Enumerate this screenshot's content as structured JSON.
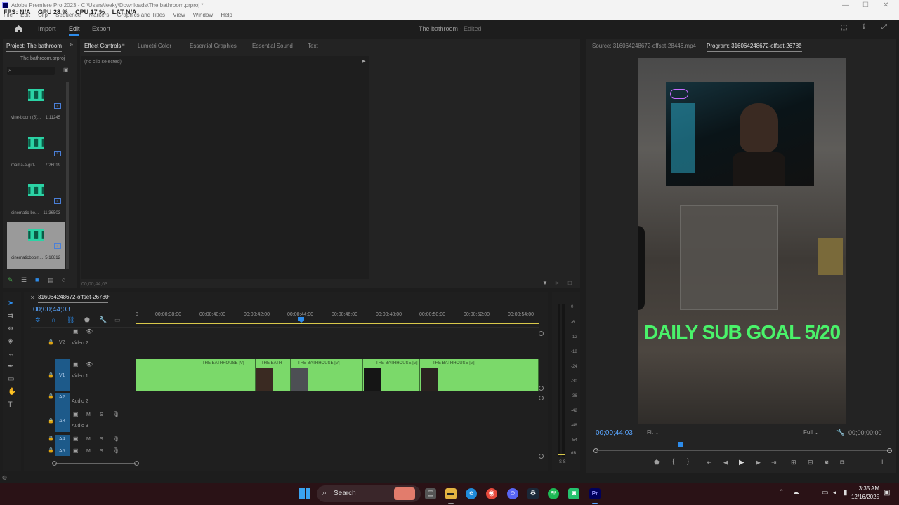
{
  "window": {
    "title": "Adobe Premiere Pro 2023 - C:\\Users\\leeky\\Downloads\\The bathroom.prproj *",
    "menus": [
      "File",
      "Edit",
      "Clip",
      "Sequence",
      "Markers",
      "Graphics and Titles",
      "View",
      "Window",
      "Help"
    ],
    "controls": {
      "minimize": "—",
      "maximize": "☐",
      "close": "✕"
    }
  },
  "overlay": {
    "fps": "FPS: N/A",
    "gpu": "GPU 28 %",
    "cpu": "CPU 17 %",
    "lat": "LAT N/A"
  },
  "nav": {
    "import": "Import",
    "edit": "Edit",
    "export": "Export",
    "doc_title": "The bathroom",
    "doc_status": "- Edited"
  },
  "project": {
    "tab": "Project: The bathroom",
    "file": "The bathroom.prproj",
    "items": [
      {
        "name": "vine-boom (5)...",
        "duration": "1:11245"
      },
      {
        "name": "mama-a-girl-...",
        "duration": "7:26019"
      },
      {
        "name": "cinematic-bo...",
        "duration": "11:36503"
      },
      {
        "name": "cinematicboom...",
        "duration": "5:16812"
      }
    ]
  },
  "effect_tabs": {
    "effect_controls": "Effect Controls",
    "lumetri": "Lumetri Color",
    "graphics": "Essential Graphics",
    "sound": "Essential Sound",
    "text": "Text"
  },
  "effect_controls": {
    "empty": "(no clip selected)",
    "timecode": "00;00;44;03"
  },
  "source_tab": "Source: 316064248672-offset-28446.mp4",
  "program_tab": "Program: 316064248672-offset-26780",
  "program": {
    "overlay_text": "DAILY SUB GOAL 5/20",
    "timecode": "00;00;44;03",
    "fit": "Fit",
    "quality": "Full",
    "duration": "00;00;00;00",
    "accent": "#4af26a"
  },
  "timeline": {
    "sequence": "316064248672-offset-26780",
    "timecode": "00;00;44;03",
    "ruler": [
      "0",
      "00;00;38;00",
      "00;00;40;00",
      "00;00;42;00",
      "00;00;44;00",
      "00;00;46;00",
      "00;00;48;00",
      "00;00;50;00",
      "00;00;52;00",
      "00;00;54;00"
    ],
    "tracks": {
      "v2": "V2",
      "v2_name": "Video 2",
      "v1": "V1",
      "v1_name": "Video 1",
      "a2": "A2",
      "a2_name": "Audio 2",
      "a3": "A3",
      "a3_name": "Audio 3",
      "a4": "A4",
      "a5": "A5"
    },
    "clip_labels": [
      "THE BATHHOUSE [V]",
      "THE BATH",
      "THE BATHHOUSE [V]",
      "THE BATHHOUSE [V]",
      "THE BATHHOUSE [V]"
    ],
    "clip_color": "#7bd96a"
  },
  "meter": {
    "labels": [
      "0",
      "-6",
      "-12",
      "-18",
      "-24",
      "-30",
      "-36",
      "-42",
      "-48",
      "-54",
      "dB"
    ],
    "solo": "S S"
  },
  "taskbar": {
    "search": "Search",
    "time": "3:35 AM",
    "date": "12/16/2025"
  }
}
